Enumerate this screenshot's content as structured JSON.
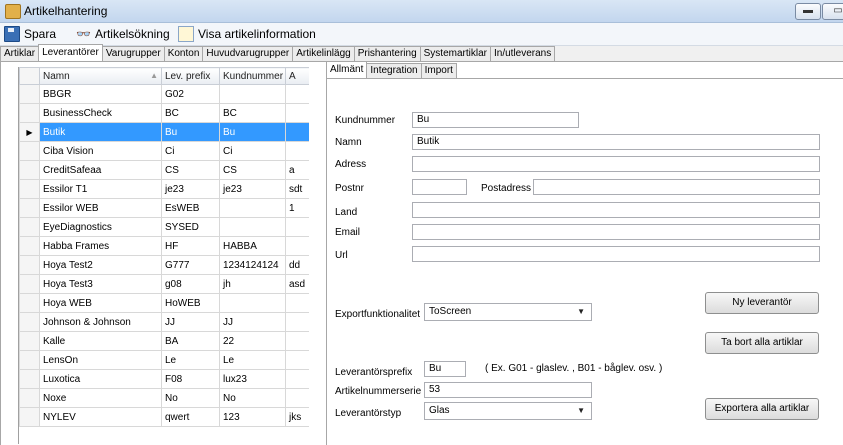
{
  "window": {
    "title": "Artikelhantering"
  },
  "toolbar": {
    "save": "Spara",
    "search": "Artikelsökning",
    "show_info": "Visa artikelinformation"
  },
  "outer_tabs": [
    "Artiklar",
    "Leverantörer",
    "Varugrupper",
    "Konton",
    "Huvudvarugrupper",
    "Artikelinlägg",
    "Prishantering",
    "Systemartiklar",
    "In/utleverans"
  ],
  "inner_tabs": [
    "Allmänt",
    "Integration",
    "Import"
  ],
  "grid": {
    "columns": [
      "Namn",
      "Lev. prefix",
      "Kundnummer",
      "A"
    ],
    "rows": [
      [
        "BBGR",
        "G02",
        "",
        ""
      ],
      [
        "BusinessCheck",
        "BC",
        "BC",
        ""
      ],
      [
        "Butik",
        "Bu",
        "Bu",
        ""
      ],
      [
        "Ciba Vision",
        "Ci",
        "Ci",
        ""
      ],
      [
        "CreditSafeaa",
        "CS",
        "CS",
        "a"
      ],
      [
        "Essilor T1",
        "je23",
        "je23",
        "sdt"
      ],
      [
        "Essilor WEB",
        "EsWEB",
        "",
        "1"
      ],
      [
        "EyeDiagnostics",
        "SYSED",
        "",
        ""
      ],
      [
        "Habba Frames",
        "HF",
        "HABBA",
        ""
      ],
      [
        "Hoya Test2",
        "G777",
        "1234124124",
        "dd"
      ],
      [
        "Hoya Test3",
        "g08",
        "jh",
        "asd"
      ],
      [
        "Hoya WEB",
        "HoWEB",
        "",
        ""
      ],
      [
        "Johnson & Johnson",
        "JJ",
        "JJ",
        ""
      ],
      [
        "Kalle",
        "BA",
        "22",
        ""
      ],
      [
        "LensOn",
        "Le",
        "Le",
        ""
      ],
      [
        "Luxotica",
        "F08",
        "lux23",
        ""
      ],
      [
        "Noxe",
        "No",
        "No",
        ""
      ],
      [
        "NYLEV",
        "qwert",
        "123",
        "jks"
      ]
    ],
    "selected_row": 2,
    "selected_marker": "▶"
  },
  "form": {
    "kundnummer_label": "Kundnummer",
    "kundnummer_value": "Bu",
    "namn_label": "Namn",
    "namn_value": "Butik",
    "adress_label": "Adress",
    "adress_value": "",
    "postnr_label": "Postnr",
    "postnr_value": "",
    "postadress_label": "Postadress",
    "postadress_value": "",
    "land_label": "Land",
    "land_value": "",
    "email_label": "Email",
    "email_value": "",
    "url_label": "Url",
    "url_value": "",
    "export_label": "Exportfunktionalitet",
    "export_value": "ToScreen",
    "prefix_label": "Leverantörsprefix",
    "prefix_value": "Bu",
    "prefix_hint": "( Ex. G01 - glaslev. , B01 - båglev. osv. )",
    "serie_label": "Artikelnummerserie",
    "serie_value": "53",
    "typ_label": "Leverantörstyp",
    "typ_value": "Glas"
  },
  "buttons": {
    "new_supplier": "Ny leverantör",
    "remove_all": "Ta bort alla artiklar",
    "export_all": "Exportera alla artiklar"
  }
}
